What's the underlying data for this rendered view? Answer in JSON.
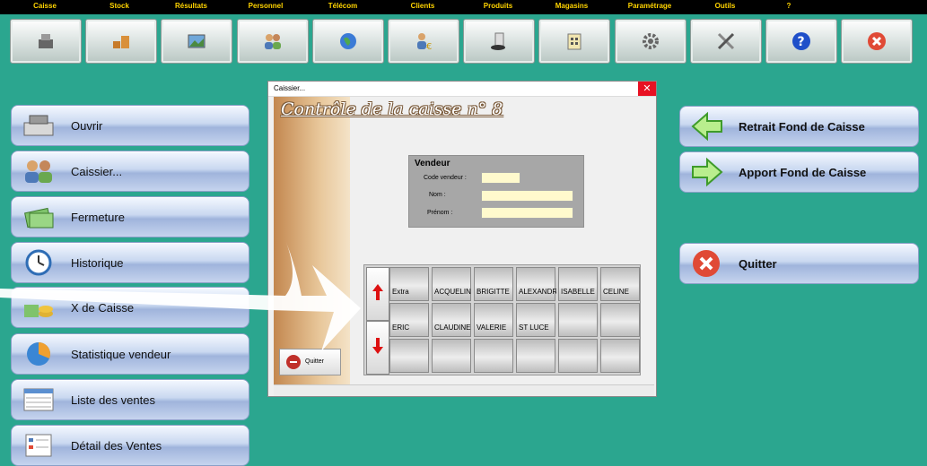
{
  "menu": [
    "Caisse",
    "Stock",
    "Résultats",
    "Personnel",
    "Télécom",
    "Clients",
    "Produits",
    "Magasins",
    "Paramétrage",
    "Outils",
    "?"
  ],
  "toolbar_icons": [
    "cash-register-icon",
    "boxes-icon",
    "picture-icon",
    "people-icon",
    "globe-icon",
    "client-euro-icon",
    "product-icon",
    "store-icon",
    "gears-icon",
    "tools-icon",
    "help-icon",
    "exit-icon"
  ],
  "left_buttons": [
    "Ouvrir",
    "Caissier...",
    "Fermeture",
    "Historique",
    "X de Caisse",
    "Statistique vendeur",
    "Liste des ventes",
    "Détail des Ventes"
  ],
  "right_buttons": {
    "retrait": "Retrait Fond de Caisse",
    "apport": "Apport Fond de Caisse",
    "quitter": "Quitter"
  },
  "dialog": {
    "window_title": "Caissier...",
    "close": "✕",
    "heading": "Contrôle de la caisse n° 8",
    "vendeur": {
      "header": "Vendeur",
      "code_label": "Code vendeur :",
      "nom_label": "Nom :",
      "prenom_label": "Prénom :",
      "code_value": "",
      "nom_value": "",
      "prenom_value": ""
    },
    "sellers": [
      [
        "Extra",
        "ACQUELIN",
        "BRIGITTE",
        "ALEXANDRI",
        "ISABELLE",
        "CELINE"
      ],
      [
        "ERIC",
        "CLAUDINE",
        "VALERIE",
        "ST LUCE",
        "",
        ""
      ],
      [
        "",
        "",
        "",
        "",
        "",
        ""
      ]
    ],
    "quit_label": "Quitter"
  },
  "colors": {
    "background": "#2ba68f",
    "menu_text": "#ffd400",
    "close": "#e81123"
  }
}
